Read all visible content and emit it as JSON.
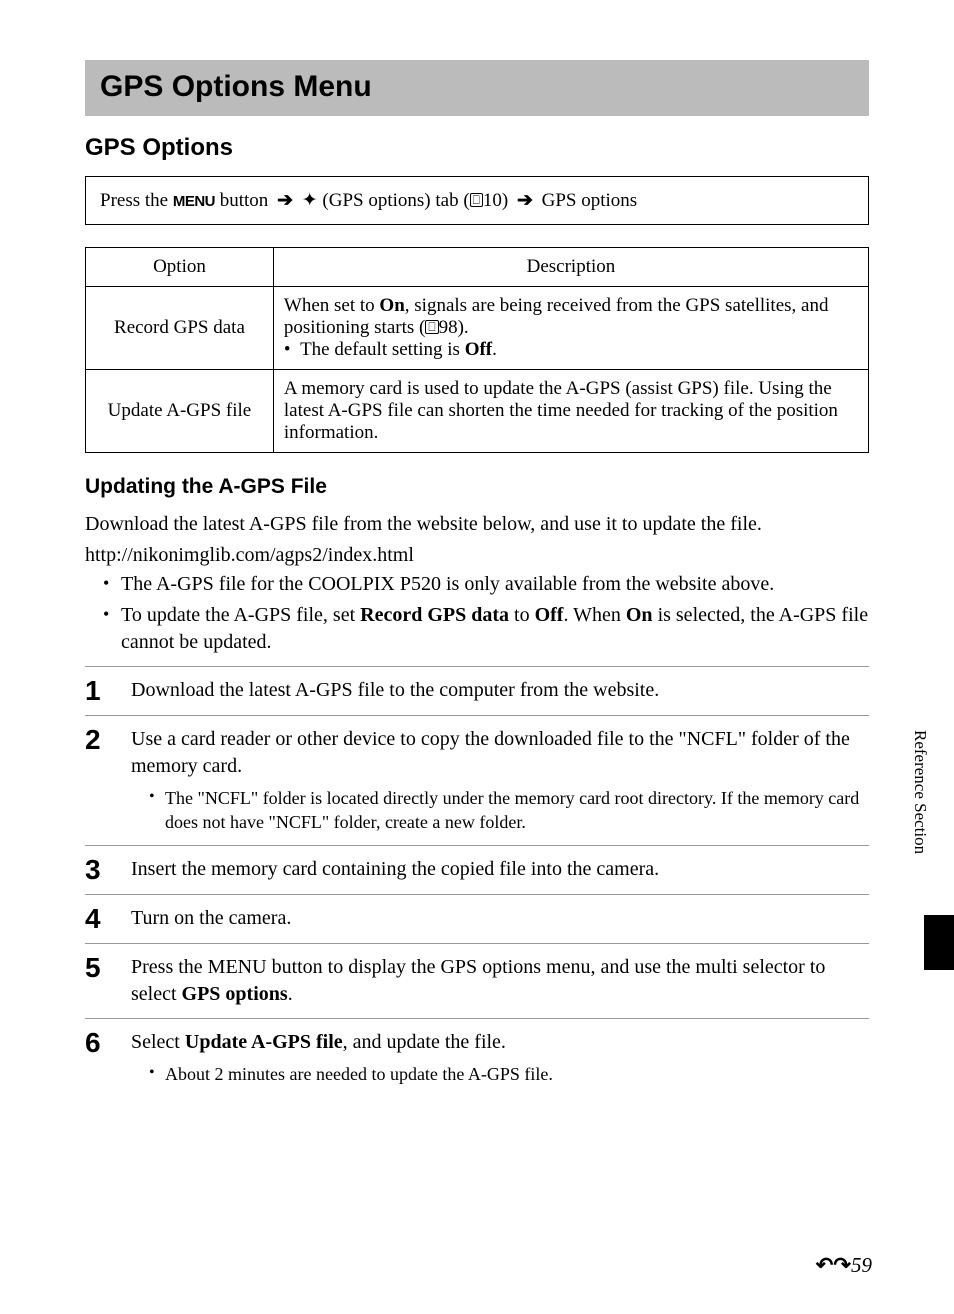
{
  "page_title": "GPS Options Menu",
  "section_title": "GPS Options",
  "nav": {
    "prefix": "Press the ",
    "menu": "MENU",
    "mid1": " button ",
    "tab_label": " (GPS options) tab (",
    "page_ref": "10) ",
    "end": " GPS options"
  },
  "table": {
    "headers": {
      "option": "Option",
      "desc": "Description"
    },
    "rows": [
      {
        "option": "Record GPS data",
        "desc_pre": "When set to ",
        "desc_bold1": "On",
        "desc_mid": ", signals are being received from the GPS satellites, and positioning starts (",
        "desc_ref": "98).",
        "bullet_pre": "The default setting is ",
        "bullet_bold": "Off",
        "bullet_post": "."
      },
      {
        "option": "Update A-GPS file",
        "desc": "A memory card is used to update the A-GPS (assist GPS) file. Using the latest A-GPS file can shorten the time needed for tracking of the position information."
      }
    ]
  },
  "subhead": "Updating the A-GPS File",
  "intro1": "Download the latest A-GPS file from the website below, and use it to update the file.",
  "url": "http://nikonimglib.com/agps2/index.html",
  "bullets": [
    "The A-GPS file for the COOLPIX P520 is only available from the website above.",
    {
      "pre": "To update the A-GPS file, set ",
      "b1": "Record GPS data",
      "mid1": " to ",
      "b2": "Off",
      "mid2": ". When ",
      "b3": "On",
      "post": " is selected, the A-GPS file cannot be updated."
    }
  ],
  "steps": [
    {
      "n": "1",
      "text": "Download the latest A-GPS file to the computer from the website."
    },
    {
      "n": "2",
      "text": "Use a card reader or other device to copy the downloaded file to the \"NCFL\" folder of the memory card.",
      "sub": "The \"NCFL\" folder is located directly under the memory card root directory. If the memory card does not have \"NCFL\" folder, create a new folder."
    },
    {
      "n": "3",
      "text": "Insert the memory card containing the copied file into the camera."
    },
    {
      "n": "4",
      "text": "Turn on the camera."
    },
    {
      "n": "5",
      "pre": "Press the ",
      "menu": "MENU",
      "mid": " button to display the GPS options menu, and use the multi selector to select ",
      "b1": "GPS options",
      "post": "."
    },
    {
      "n": "6",
      "pre": "Select ",
      "b1": "Update A-GPS file",
      "post": ", and update the file.",
      "sub": "About 2 minutes are needed to update the A-GPS file."
    }
  ],
  "side_label": "Reference Section",
  "page_number": "59"
}
